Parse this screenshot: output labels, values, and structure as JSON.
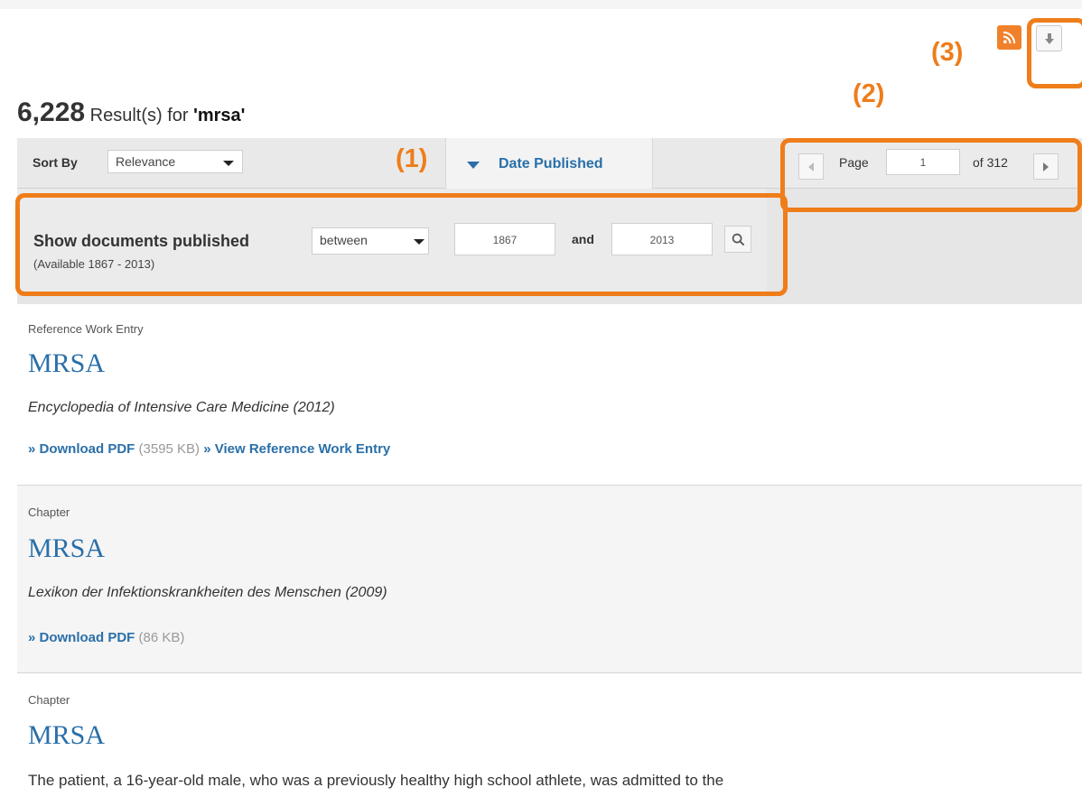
{
  "header": {
    "count": "6,228",
    "results_text": "Result(s) for",
    "query": "'mrsa'"
  },
  "annotations": {
    "a1": "(1)",
    "a2": "(2)",
    "a3": "(3)",
    "color": "#ef7d1a"
  },
  "toolbar": {
    "sort_label": "Sort By",
    "sort_value": "Relevance",
    "date_tab_label": "Date Published",
    "pager": {
      "page_label": "Page",
      "page_value": "1",
      "of_label": "of 312"
    }
  },
  "filter": {
    "title": "Show documents published",
    "subtitle": "(Available 1867 - 2013)",
    "mode": "between",
    "from_year": "1867",
    "and_label": "and",
    "to_year": "2013"
  },
  "icons": {
    "rss": "rss-icon",
    "download": "download-icon",
    "search": "search-icon"
  },
  "results": [
    {
      "type": "Reference Work Entry",
      "title": "MRSA",
      "source": "Encyclopedia of Intensive Care Medicine (2012)",
      "download_label": "» Download PDF",
      "size": "(3595 KB)",
      "view_label": "» View Reference Work Entry"
    },
    {
      "type": "Chapter",
      "title": "MRSA",
      "source": "Lexikon der Infektionskrankheiten des Menschen (2009)",
      "download_label": "» Download PDF",
      "size": "(86 KB)"
    },
    {
      "type": "Chapter",
      "title": "MRSA",
      "snippet": "The patient, a 16-year-old male, who was a previously healthy high school athlete, was admitted to the"
    }
  ],
  "colors": {
    "accent": "#2a6fa8",
    "rss": "#f0812a"
  }
}
